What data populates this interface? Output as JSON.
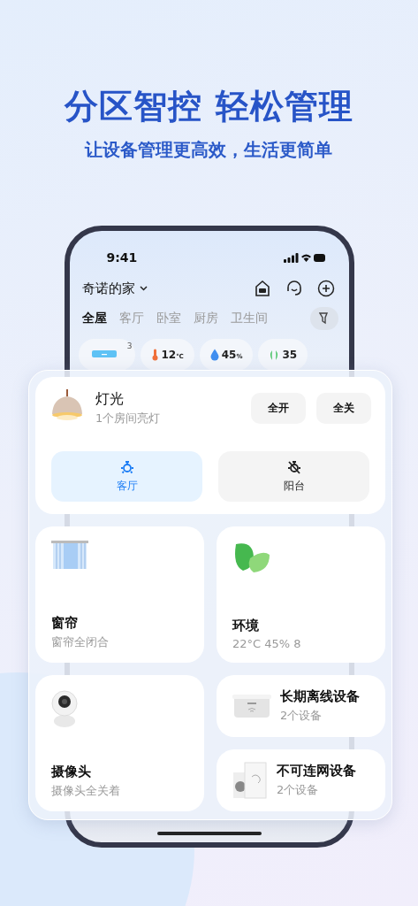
{
  "headline": "分区智控 轻松管理",
  "subheadline": "让设备管理更高效，生活更简单",
  "phone": {
    "status_time": "9:41",
    "home_name": "奇诺的家",
    "rooms": [
      {
        "label": "全屋",
        "selected": true
      },
      {
        "label": "客厅",
        "selected": false
      },
      {
        "label": "卧室",
        "selected": false
      },
      {
        "label": "厨房",
        "selected": false
      },
      {
        "label": "卫生间",
        "selected": false
      }
    ],
    "chips": [
      {
        "kind": "ac",
        "badge": "3"
      },
      {
        "kind": "temperature",
        "value": "12",
        "unit": "℃"
      },
      {
        "kind": "humidity",
        "value": "45",
        "unit": "%"
      },
      {
        "kind": "air",
        "value": "35"
      }
    ]
  },
  "lighting": {
    "title": "灯光",
    "subtitle": "1个房间亮灯",
    "buttons": [
      "全开",
      "全关"
    ],
    "rooms": [
      {
        "label": "客厅",
        "on": true
      },
      {
        "label": "阳台",
        "on": false
      }
    ]
  },
  "tiles": [
    {
      "kind": "curtain",
      "title": "窗帘",
      "subtitle": "窗帘全闭合"
    },
    {
      "kind": "environment",
      "title": "环境",
      "subtitle": "22°C 45% 8"
    },
    {
      "kind": "camera",
      "title": "摄像头",
      "subtitle": "摄像头全关着"
    },
    {
      "kind": "offline",
      "title": "长期离线设备",
      "subtitle": "2个设备"
    },
    {
      "kind": "unconnectable",
      "title": "不可连网设备",
      "subtitle": "2个设备"
    }
  ]
}
